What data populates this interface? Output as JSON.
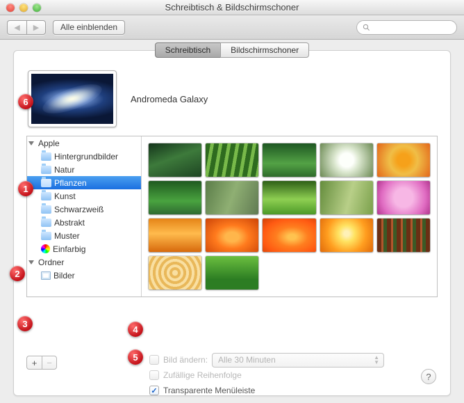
{
  "window": {
    "title": "Schreibtisch & Bildschirmschoner"
  },
  "toolbar": {
    "back_icon": "◀",
    "fwd_icon": "▶",
    "show_all": "Alle einblenden"
  },
  "tabs": {
    "desktop": "Schreibtisch",
    "screensaver": "Bildschirmschoner"
  },
  "current_wallpaper": {
    "name": "Andromeda Galaxy"
  },
  "sidebar": {
    "groups": [
      {
        "label": "Apple",
        "items": [
          {
            "label": "Hintergrundbilder",
            "type": "folder"
          },
          {
            "label": "Natur",
            "type": "folder"
          },
          {
            "label": "Pflanzen",
            "type": "folder",
            "selected": true
          },
          {
            "label": "Kunst",
            "type": "folder"
          },
          {
            "label": "Schwarzweiß",
            "type": "folder"
          },
          {
            "label": "Abstrakt",
            "type": "folder"
          },
          {
            "label": "Muster",
            "type": "folder"
          },
          {
            "label": "Einfarbig",
            "type": "colorwheel"
          }
        ]
      },
      {
        "label": "Ordner",
        "items": [
          {
            "label": "Bilder",
            "type": "picframe"
          }
        ]
      }
    ]
  },
  "thumbs": [
    "linear-gradient(160deg,#14351b,#3d7a3b 45%,#1e4523)",
    "repeating-linear-gradient(100deg,#2e6b1f 0 7px,#78b94a 7px 12px)",
    "linear-gradient(#1e5722,#53a245 60%,#2e6b2b)",
    "radial-gradient(circle at 50% 50%,#fdfffb 0 22%,#dbe7cf 40%,#6c8a54 100%)",
    "radial-gradient(circle,#f6a11a 0 20%,#f0be47 45%,#e3671a)",
    "linear-gradient(#1f5a1f,#49a33f 60%,#2f6a31)",
    "linear-gradient(110deg,#5b7d49,#8faf73 50%,#607a52)",
    "linear-gradient(#2e5f17,#8ecf52 55%,#4c9928)",
    "linear-gradient(105deg,#658d3d,#b8cf88 55%,#7aa04b)",
    "radial-gradient(circle at 50% 50%,#f7b7e5 0 30%,#e06cc2 70%,#b2368f)",
    "linear-gradient(#e58417,#ffbb4d 45%,#d7690c)",
    "radial-gradient(ellipse at 50% 55%,#ffb64b 0 18%,#ff7a1d 45%,#cc4407)",
    "radial-gradient(ellipse at 55% 55%,#ffc24f 0 10%,#ff7e1f 38%,#ff5a12 70%,#d04108)",
    "radial-gradient(circle at 50% 45%,#fff1b7 0 8%,#ffe362 25%,#ff9d1f 60%,#e06a0a)",
    "repeating-linear-gradient(90deg,#6a2f14 0 6px,#b1562c 6px 9px,#3b5a26 9px 14px)",
    "repeating-radial-gradient(circle,#f9dfa1 0 4px,#e9b85a 4px 8px)",
    "linear-gradient(#6bbf3f,#2c7d23 70%)"
  ],
  "options": {
    "change_label": "Bild ändern:",
    "interval": "Alle 30 Minuten",
    "random_label": "Zufällige Reihenfolge",
    "transparent_label": "Transparente Menüleiste"
  },
  "buttons": {
    "plus": "+",
    "minus": "−",
    "help": "?"
  },
  "callouts": {
    "1": "1",
    "2": "2",
    "3": "3",
    "4": "4",
    "5": "5",
    "6": "6"
  }
}
